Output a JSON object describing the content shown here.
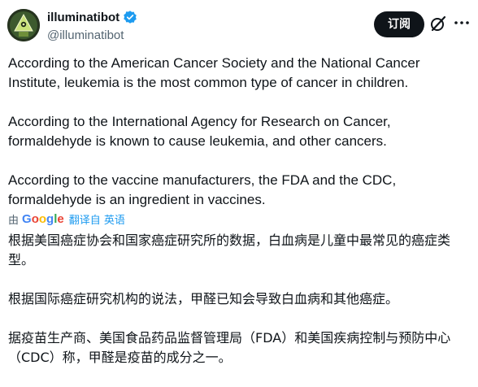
{
  "author": {
    "display_name": "illuminatibot",
    "handle": "@illuminatibot"
  },
  "actions": {
    "subscribe_label": "订阅",
    "grok_icon": "grok-slash-icon",
    "more_icon": "more-options-icon"
  },
  "post": {
    "paragraphs": [
      "According to the American Cancer Society and the National Cancer Institute, leukemia is the most common type of cancer in children.",
      "According to the International Agency for Research on Cancer, formaldehyde is known to cause leukemia, and other cancers.",
      "According to the vaccine manufacturers, the FDA and the CDC, formaldehyde is an ingredient in vaccines."
    ]
  },
  "translation": {
    "by_label": "由",
    "provider": "Google",
    "action_label": "翻译自 英语",
    "paragraphs": [
      "根据美国癌症协会和国家癌症研究所的数据，白血病是儿童中最常见的癌症类型。",
      "根据国际癌症研究机构的说法，甲醛已知会导致白血病和其他癌症。",
      "据疫苗生产商、美国食品药品监督管理局（FDA）和美国疾病控制与预防中心（CDC）称，甲醛是疫苗的成分之一。"
    ]
  },
  "colors": {
    "text": "#0f1419",
    "secondary": "#536471",
    "link": "#1d9bf0",
    "verified": "#1d9bf0",
    "button_bg": "#0f1419"
  }
}
